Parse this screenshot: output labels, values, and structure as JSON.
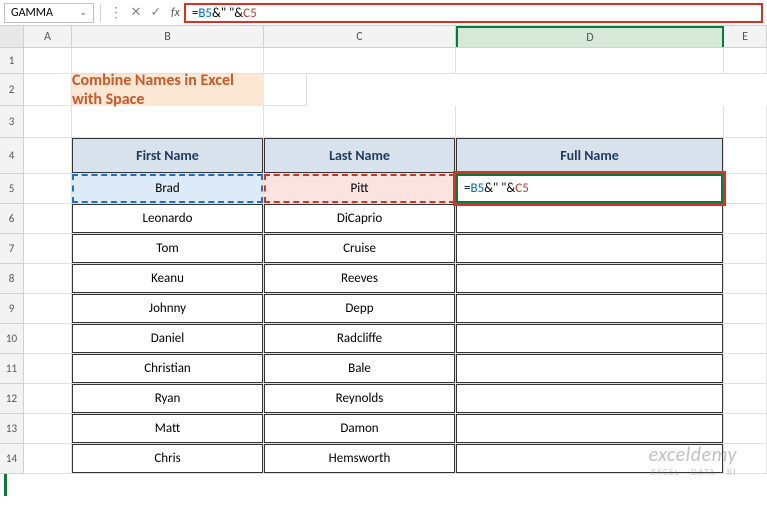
{
  "formula_bar": {
    "name_box": "GAMMA",
    "formula_plain": "=B5&\" \"&C5",
    "formula_parts": {
      "eq": "=",
      "ref1": "B5",
      "amp1": "&",
      "str": "\" \"",
      "amp2": "&",
      "ref2": "C5"
    }
  },
  "columns": {
    "a": "A",
    "b": "B",
    "c": "C",
    "d": "D",
    "e": "E"
  },
  "rows": [
    "1",
    "2",
    "3",
    "4",
    "5",
    "6",
    "7",
    "8",
    "9",
    "10",
    "11",
    "12",
    "13",
    "14"
  ],
  "title": "Combine Names in Excel with Space",
  "headers": {
    "first": "First Name",
    "last": "Last Name",
    "full": "Full Name"
  },
  "data": [
    {
      "first": "Brad",
      "last": "Pitt"
    },
    {
      "first": "Leonardo",
      "last": "DiCaprio"
    },
    {
      "first": "Tom",
      "last": "Cruise"
    },
    {
      "first": "Keanu",
      "last": "Reeves"
    },
    {
      "first": "Johnny",
      "last": "Depp"
    },
    {
      "first": "Daniel",
      "last": "Radcliffe"
    },
    {
      "first": "Christian",
      "last": "Bale"
    },
    {
      "first": "Ryan",
      "last": "Reynolds"
    },
    {
      "first": "Matt",
      "last": "Damon"
    },
    {
      "first": "Chris",
      "last": "Hemsworth"
    }
  ],
  "active_cell_parts": {
    "eq": "=",
    "ref1": "B5",
    "amp1": "&",
    "str": "\" \"",
    "amp2": "&",
    "ref2": "C5"
  },
  "watermark": {
    "brand": "exceldemy",
    "sub": "EXCEL · DATA · BI"
  },
  "icons": {
    "chevron": "⌄",
    "cancel": "✕",
    "confirm": "✓",
    "dots": "⋮"
  }
}
